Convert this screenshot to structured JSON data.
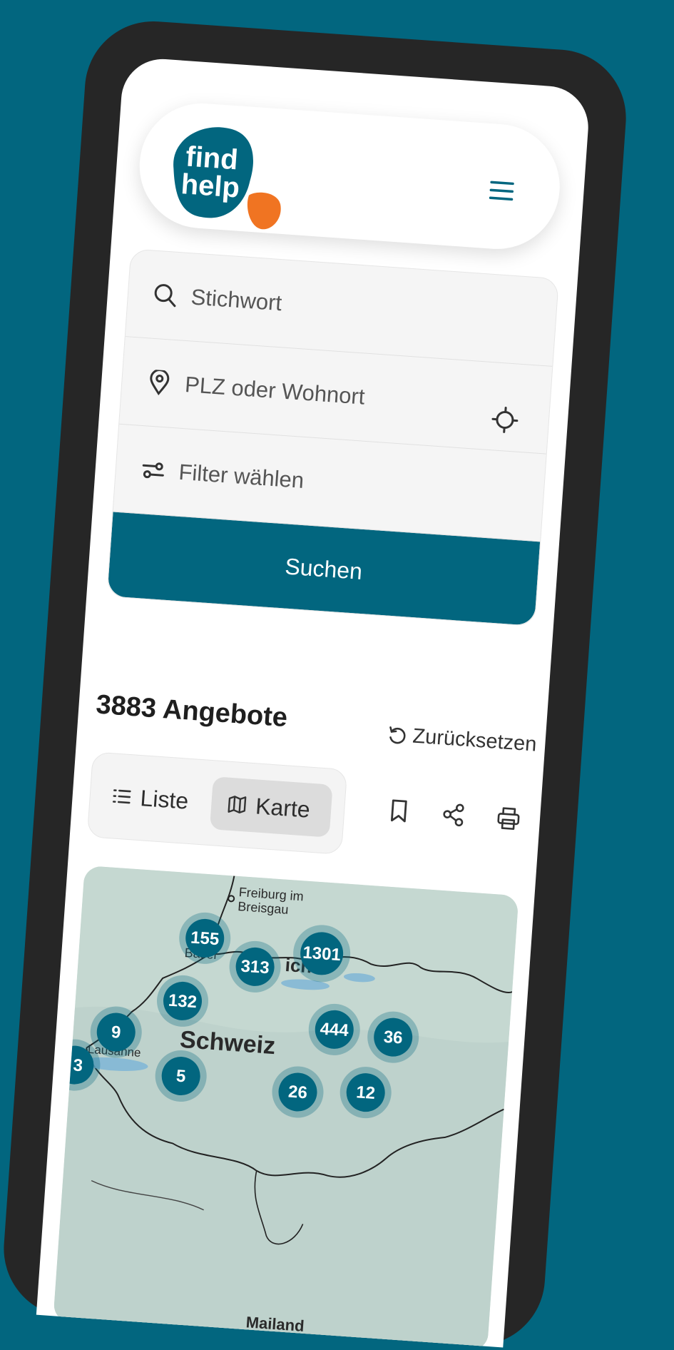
{
  "logo": {
    "line1": "find",
    "line2": "help",
    "brand_color": "#02667f",
    "accent_color": "#f07422"
  },
  "header": {
    "menu_icon": "hamburger-icon"
  },
  "search": {
    "keyword_placeholder": "Stichwort",
    "location_placeholder": "PLZ oder Wohnort",
    "filter_label": "Filter wählen",
    "submit_label": "Suchen"
  },
  "results": {
    "count_label": "3883 Angebote",
    "reset_label": "Zurücksetzen"
  },
  "view_toggle": {
    "list_label": "Liste",
    "map_label": "Karte",
    "selected": "Karte"
  },
  "actions": [
    "bookmark-icon",
    "share-icon",
    "print-icon"
  ],
  "map": {
    "country_label": "Schweiz",
    "places": {
      "freiburg": "Freiburg im Breisgau",
      "freiburg_line1": "Freiburg im",
      "freiburg_line2": "Breisgau",
      "basel": "Basel",
      "zurich": "ich",
      "lausanne": "Lausanne",
      "milan": "Mailand"
    },
    "clusters": [
      "155",
      "1301",
      "313",
      "132",
      "9",
      "444",
      "36",
      "3",
      "5",
      "26",
      "12"
    ]
  },
  "colors": {
    "primary": "#02667f",
    "frame": "#262626",
    "map_land": "#c8d9d3"
  }
}
